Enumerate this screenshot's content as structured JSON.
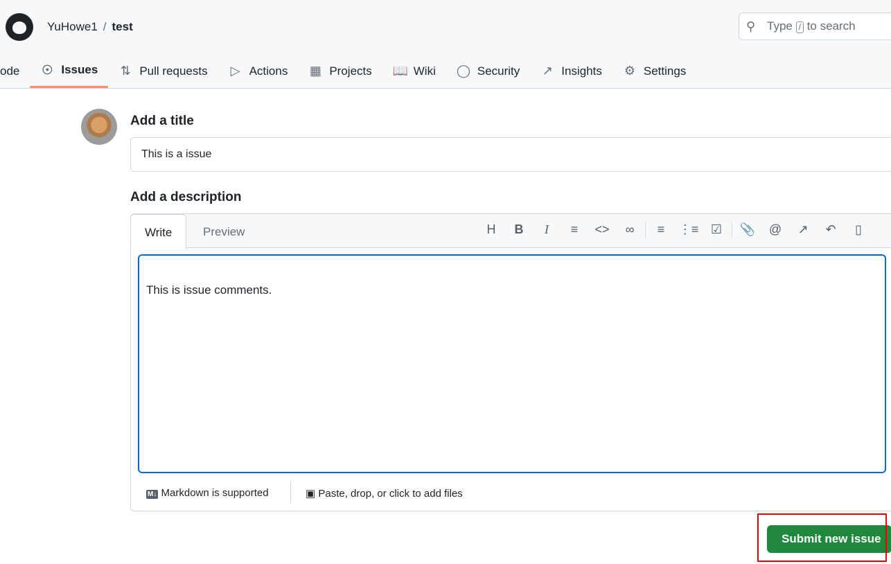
{
  "header": {
    "owner": "YuHowe1",
    "separator": "/",
    "repo": "test",
    "search_prefix": "Type",
    "search_key": "/",
    "search_suffix": "to search"
  },
  "nav": [
    {
      "label": "ode",
      "icon": "code-icon"
    },
    {
      "label": "Issues",
      "icon": "issue-icon"
    },
    {
      "label": "Pull requests",
      "icon": "pull-request-icon"
    },
    {
      "label": "Actions",
      "icon": "play-icon"
    },
    {
      "label": "Projects",
      "icon": "table-icon"
    },
    {
      "label": "Wiki",
      "icon": "book-icon"
    },
    {
      "label": "Security",
      "icon": "shield-icon"
    },
    {
      "label": "Insights",
      "icon": "graph-icon"
    },
    {
      "label": "Settings",
      "icon": "gear-icon"
    }
  ],
  "form": {
    "title_label": "Add a title",
    "title_value": "This is a issue",
    "desc_label": "Add a description",
    "write_tab": "Write",
    "preview_tab": "Preview",
    "body": "This is issue comments.",
    "markdown_note": "Markdown is supported",
    "attach_note": "Paste, drop, or click to add files",
    "submit": "Submit new issue"
  },
  "toolbar": [
    "heading-icon",
    "bold-icon",
    "italic-icon",
    "quote-icon",
    "code-icon",
    "link-icon",
    "ordered-list-icon",
    "unordered-list-icon",
    "task-list-icon",
    "attach-icon",
    "mention-icon",
    "cross-reference-icon",
    "reply-icon",
    "slash-command-icon"
  ]
}
